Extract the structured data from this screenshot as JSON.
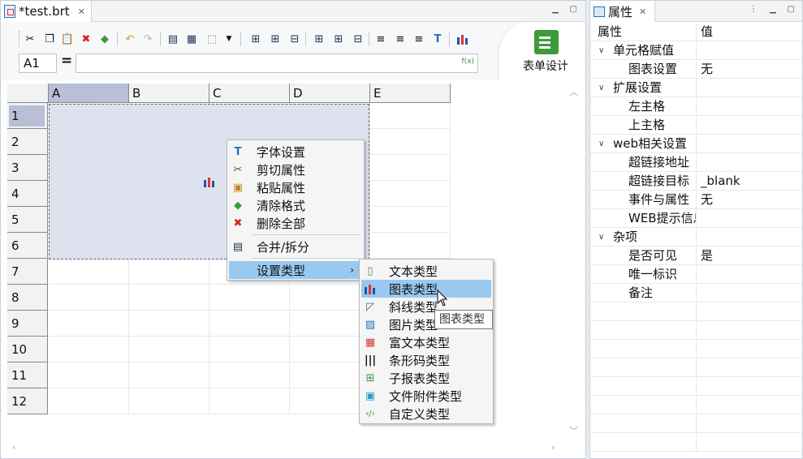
{
  "editor": {
    "tab_title": "*test.brt",
    "cell_ref": "A1",
    "equals": "=",
    "formula_value": "",
    "fx_label": "f(x)",
    "form_design_label": "表单设计",
    "columns": [
      "A",
      "B",
      "C",
      "D",
      "E"
    ],
    "rows": [
      "1",
      "2",
      "3",
      "4",
      "5",
      "6",
      "7",
      "8",
      "9",
      "10",
      "11",
      "12"
    ],
    "selected_cell": "A1",
    "merged_range": "A1:D6"
  },
  "props": {
    "tab_title": "属性",
    "col_property": "属性",
    "col_value": "值",
    "rows": [
      {
        "label": "单元格赋值",
        "value": "",
        "group": true
      },
      {
        "label": "图表设置",
        "value": "无",
        "group": false
      },
      {
        "label": "扩展设置",
        "value": "",
        "group": true
      },
      {
        "label": "左主格",
        "value": "",
        "group": false
      },
      {
        "label": "上主格",
        "value": "",
        "group": false
      },
      {
        "label": "web相关设置",
        "value": "",
        "group": true
      },
      {
        "label": "超链接地址",
        "value": "",
        "group": false
      },
      {
        "label": "超链接目标",
        "value": "_blank",
        "group": false
      },
      {
        "label": "事件与属性",
        "value": "无",
        "group": false
      },
      {
        "label": "WEB提示信息",
        "value": "",
        "group": false
      },
      {
        "label": "杂项",
        "value": "",
        "group": true
      },
      {
        "label": "是否可见",
        "value": "是",
        "group": false
      },
      {
        "label": "唯一标识",
        "value": "",
        "group": false
      },
      {
        "label": "备注",
        "value": "",
        "group": false
      }
    ]
  },
  "context_menu": {
    "items": [
      {
        "label": "字体设置",
        "icon": "font-icon"
      },
      {
        "label": "剪切属性",
        "icon": "scissors-icon"
      },
      {
        "label": "粘贴属性",
        "icon": "paste-icon"
      },
      {
        "label": "清除格式",
        "icon": "eraser-icon"
      },
      {
        "label": "删除全部",
        "icon": "delete-x-icon"
      },
      {
        "label": "合并/拆分",
        "icon": "merge-cells-icon"
      },
      {
        "label": "设置类型",
        "icon": "",
        "submenu": true
      }
    ]
  },
  "submenu": {
    "items": [
      {
        "label": "文本类型",
        "icon": "text-type-icon"
      },
      {
        "label": "图表类型",
        "icon": "chart-type-icon"
      },
      {
        "label": "斜线类型",
        "icon": "diagonal-type-icon"
      },
      {
        "label": "图片类型",
        "icon": "image-type-icon"
      },
      {
        "label": "富文本类型",
        "icon": "rich-text-type-icon"
      },
      {
        "label": "条形码类型",
        "icon": "barcode-type-icon"
      },
      {
        "label": "子报表类型",
        "icon": "subreport-type-icon"
      },
      {
        "label": "文件附件类型",
        "icon": "attachment-type-icon"
      },
      {
        "label": "自定义类型",
        "icon": "custom-type-icon"
      }
    ],
    "highlighted": "图表类型"
  },
  "tooltip": "图表类型",
  "colors": {
    "selection": "#b8bfd6",
    "merged_fill": "#dde2ee",
    "menu_highlight": "#99c9f1",
    "form_icon": "#3c9b3c"
  }
}
